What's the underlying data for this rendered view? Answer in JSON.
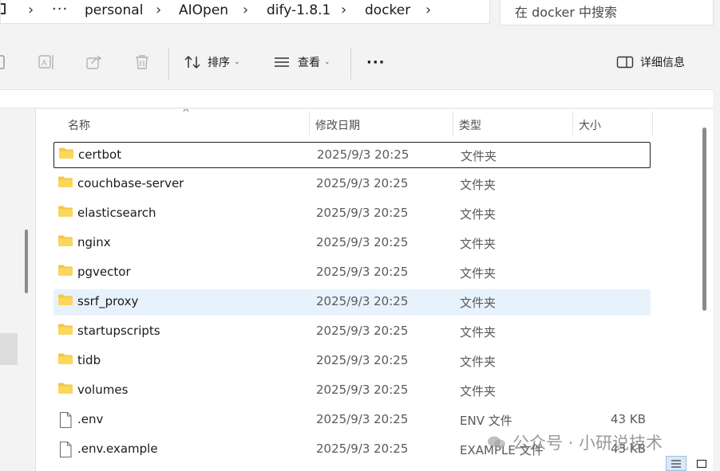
{
  "breadcrumb": {
    "more": "···",
    "items": [
      "personal",
      "AIOpen",
      "dify-1.8.1",
      "docker"
    ]
  },
  "search": {
    "placeholder": "在 docker 中搜索"
  },
  "toolbar": {
    "sort_label": "排序",
    "view_label": "查看",
    "more": "···",
    "details_label": "详细信息"
  },
  "columns": {
    "name": "名称",
    "modified": "修改日期",
    "type": "类型",
    "size": "大小"
  },
  "files": [
    {
      "name": "certbot",
      "modified": "2025/9/3 20:25",
      "type": "文件夹",
      "size": "",
      "icon": "folder-icon"
    },
    {
      "name": "couchbase-server",
      "modified": "2025/9/3 20:25",
      "type": "文件夹",
      "size": "",
      "icon": "folder-icon"
    },
    {
      "name": "elasticsearch",
      "modified": "2025/9/3 20:25",
      "type": "文件夹",
      "size": "",
      "icon": "folder-icon"
    },
    {
      "name": "nginx",
      "modified": "2025/9/3 20:25",
      "type": "文件夹",
      "size": "",
      "icon": "folder-icon"
    },
    {
      "name": "pgvector",
      "modified": "2025/9/3 20:25",
      "type": "文件夹",
      "size": "",
      "icon": "folder-icon"
    },
    {
      "name": "ssrf_proxy",
      "modified": "2025/9/3 20:25",
      "type": "文件夹",
      "size": "",
      "icon": "folder-icon"
    },
    {
      "name": "startupscripts",
      "modified": "2025/9/3 20:25",
      "type": "文件夹",
      "size": "",
      "icon": "folder-icon"
    },
    {
      "name": "tidb",
      "modified": "2025/9/3 20:25",
      "type": "文件夹",
      "size": "",
      "icon": "folder-icon"
    },
    {
      "name": "volumes",
      "modified": "2025/9/3 20:25",
      "type": "文件夹",
      "size": "",
      "icon": "folder-icon"
    },
    {
      "name": ".env",
      "modified": "2025/9/3 20:25",
      "type": "ENV 文件",
      "size": "43 KB",
      "icon": "file-icon"
    },
    {
      "name": ".env.example",
      "modified": "2025/9/3 20:25",
      "type": "EXAMPLE 文件",
      "size": "43 KB",
      "icon": "file-icon"
    }
  ],
  "watermark": "公众号 · 小研说技术"
}
